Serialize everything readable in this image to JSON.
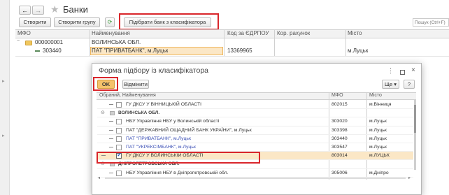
{
  "nav": {
    "back": "←",
    "forward": "→"
  },
  "window": {
    "title": "Банки"
  },
  "toolbar": {
    "create_label": "Створити",
    "create_group_label": "Створити групу",
    "pick_classifier_label": "Підібрати банк з класифікатора",
    "search_placeholder": "Пошук (Ctrl+F)"
  },
  "table": {
    "columns": [
      "МФО",
      "Найменування",
      "Код за ЄДРПОУ",
      "Кор. рахунок",
      "Місто"
    ],
    "rows": [
      {
        "mfo": "000000001",
        "name": "ВОЛИНСЬКА ОБЛ.",
        "edrpou": "",
        "kor": "",
        "city": ""
      },
      {
        "mfo": "303440",
        "name": "ПАТ \"ПРИВАТБАНК\", м.Луцьк",
        "edrpou": "13369965",
        "kor": "",
        "city": "м.Луцьк"
      }
    ]
  },
  "dialog": {
    "title": "Форма підбору із класифікатора",
    "ok_label": "OK",
    "cancel_label": "Відмінити",
    "more_label": "Ще",
    "help_label": "?",
    "columns": [
      "Обраний, Найменування",
      "МФО",
      "Місто"
    ],
    "rows": [
      {
        "name": "ГУ ДКСУ У ВІННИЦЬКІЙ ОБЛАСТІ",
        "mfo": "802015",
        "city": "м.Вінниця",
        "checked": false
      },
      {
        "name": "ВОЛИНСЬКА ОБЛ.",
        "mfo": "",
        "city": "",
        "group": true
      },
      {
        "name": "НБУ Управління НБУ у Волинській області",
        "mfo": "303020",
        "city": "м.Луцьк",
        "checked": false
      },
      {
        "name": "ПАТ \"ДЕРЖАВНИЙ ОЩАДНИЙ БАНК УКРАЇНИ\", м.Луцьк",
        "mfo": "303398",
        "city": "м.Луцьк",
        "checked": false
      },
      {
        "name": "ПАТ \"ПРИВАТБАНК\", м.Луцьк",
        "mfo": "303440",
        "city": "м.Луцьк",
        "checked": false,
        "blue": true
      },
      {
        "name": "ПАТ \"УКРЕКСІМБАНК\", м.Луцьк",
        "mfo": "303547",
        "city": "м.Луцьк",
        "checked": false,
        "blue": true
      },
      {
        "name": "ГУ ДКСУ У ВОЛИНСЬКІЙ ОБЛАСТІ",
        "mfo": "803014",
        "city": "м.ЛУЦЬК",
        "checked": true
      },
      {
        "name": "ДНІПРОПЕТРОВСЬКА ОБЛ.",
        "mfo": "",
        "city": "",
        "group": true
      },
      {
        "name": "НБУ Управління НБУ в Дніпропетровській обл.",
        "mfo": "305006",
        "city": "м.Дніпро",
        "checked": false
      }
    ]
  },
  "colors": {
    "accent": "#f5c26b",
    "selection": "#fbe7c6",
    "red": "#d9262b",
    "blue_text": "#3b4fb5"
  }
}
